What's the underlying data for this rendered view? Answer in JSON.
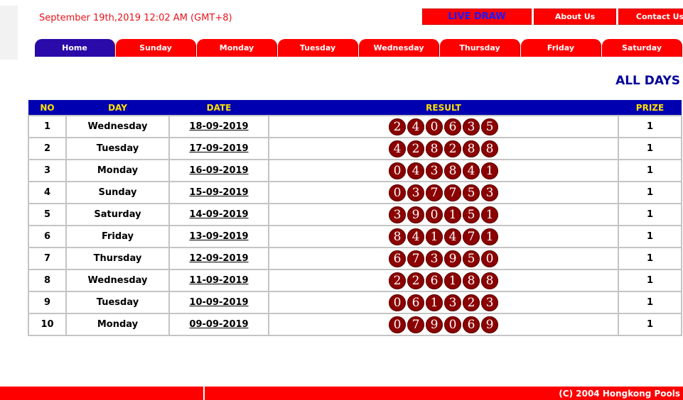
{
  "header": {
    "datetime": "September 19th,2019 12:02 AM (GMT+8)",
    "links": [
      {
        "label": "LIVE DRAW"
      },
      {
        "label": "About Us"
      },
      {
        "label": "Contact Us"
      }
    ]
  },
  "tabs": [
    {
      "label": "Home",
      "active": true
    },
    {
      "label": "Sunday"
    },
    {
      "label": "Monday"
    },
    {
      "label": "Tuesday"
    },
    {
      "label": "Wednesday"
    },
    {
      "label": "Thursday"
    },
    {
      "label": "Friday"
    },
    {
      "label": "Saturday"
    }
  ],
  "section_title": "ALL DAYS",
  "table": {
    "headers": [
      "NO",
      "DAY",
      "DATE",
      "RESULT",
      "PRIZE"
    ],
    "rows": [
      {
        "no": "1",
        "day": "Wednesday",
        "date": "18-09-2019",
        "result": [
          "2",
          "4",
          "0",
          "6",
          "3",
          "5"
        ],
        "prize": "1"
      },
      {
        "no": "2",
        "day": "Tuesday",
        "date": "17-09-2019",
        "result": [
          "4",
          "2",
          "8",
          "2",
          "8",
          "8"
        ],
        "prize": "1"
      },
      {
        "no": "3",
        "day": "Monday",
        "date": "16-09-2019",
        "result": [
          "0",
          "4",
          "3",
          "8",
          "4",
          "1"
        ],
        "prize": "1"
      },
      {
        "no": "4",
        "day": "Sunday",
        "date": "15-09-2019",
        "result": [
          "0",
          "3",
          "7",
          "7",
          "5",
          "3"
        ],
        "prize": "1"
      },
      {
        "no": "5",
        "day": "Saturday",
        "date": "14-09-2019",
        "result": [
          "3",
          "9",
          "0",
          "1",
          "5",
          "1"
        ],
        "prize": "1"
      },
      {
        "no": "6",
        "day": "Friday",
        "date": "13-09-2019",
        "result": [
          "8",
          "4",
          "1",
          "4",
          "7",
          "1"
        ],
        "prize": "1"
      },
      {
        "no": "7",
        "day": "Thursday",
        "date": "12-09-2019",
        "result": [
          "6",
          "7",
          "3",
          "9",
          "5",
          "0"
        ],
        "prize": "1"
      },
      {
        "no": "8",
        "day": "Wednesday",
        "date": "11-09-2019",
        "result": [
          "2",
          "2",
          "6",
          "1",
          "8",
          "8"
        ],
        "prize": "1"
      },
      {
        "no": "9",
        "day": "Tuesday",
        "date": "10-09-2019",
        "result": [
          "0",
          "6",
          "1",
          "3",
          "2",
          "3"
        ],
        "prize": "1"
      },
      {
        "no": "10",
        "day": "Monday",
        "date": "09-09-2019",
        "result": [
          "0",
          "7",
          "9",
          "0",
          "6",
          "9"
        ],
        "prize": "1"
      }
    ]
  },
  "footer": {
    "copyright": "(C) 2004 Hongkong Pools"
  },
  "colors": {
    "brand_red": "#ff0000",
    "header_blue": "#0000b0",
    "active_tab": "#2a0aa8",
    "ball": "#8b0000",
    "header_text": "#ffe100"
  }
}
